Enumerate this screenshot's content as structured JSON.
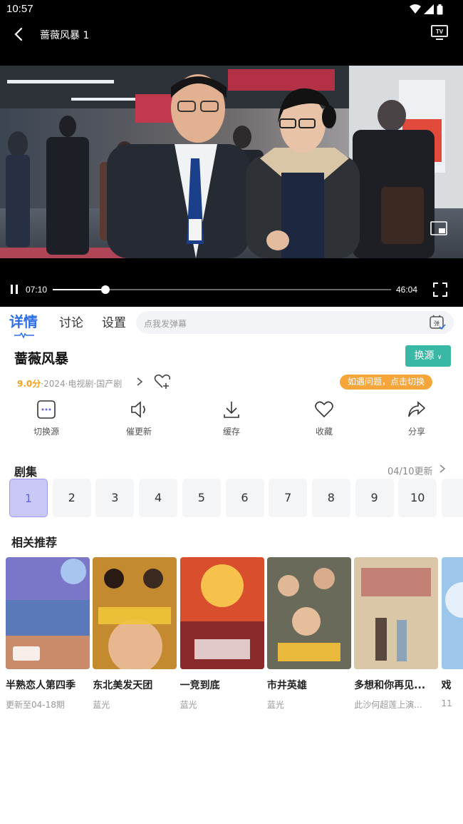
{
  "status": {
    "time": "10:57"
  },
  "player": {
    "title": "蔷薇风暴 1",
    "current_time": "07:10",
    "duration": "46:04",
    "progress": 0.155
  },
  "tabs": [
    {
      "label": "详情",
      "active": true
    },
    {
      "label": "讨论",
      "active": false
    },
    {
      "label": "设置",
      "active": false
    }
  ],
  "danmaku": {
    "placeholder": "点我发弹幕"
  },
  "show": {
    "title": "蔷薇风暴",
    "source_button": "换源",
    "score": "9.0分",
    "meta": "·2024·电视剧·国产剧",
    "tip": "如遇问题，点击切换"
  },
  "actions": [
    {
      "label": "切换源",
      "icon": "switch-source-icon"
    },
    {
      "label": "催更新",
      "icon": "speaker-icon"
    },
    {
      "label": "缓存",
      "icon": "download-icon"
    },
    {
      "label": "收藏",
      "icon": "heart-icon"
    },
    {
      "label": "分享",
      "icon": "share-icon"
    }
  ],
  "episodes": {
    "title": "剧集",
    "update": "04/10更新",
    "items": [
      "1",
      "2",
      "3",
      "4",
      "5",
      "6",
      "7",
      "8",
      "9",
      "10"
    ],
    "selected": "1"
  },
  "recommend": {
    "title": "相关推荐",
    "items": [
      {
        "name": "半熟恋人第四季",
        "sub": "更新至04-18期"
      },
      {
        "name": "东北美发天团",
        "sub": "蓝光"
      },
      {
        "name": "一竞到底",
        "sub": "蓝光"
      },
      {
        "name": "市井英雄",
        "sub": "蓝光"
      },
      {
        "name": "多想和你再见...",
        "sub": "此沙何超莲上演..."
      },
      {
        "name": "戏",
        "sub": "11"
      }
    ]
  },
  "colors": {
    "accent": "#2e6fe6",
    "source_button": "#3ab8a6",
    "tip": "#f6a53a",
    "score": "#f2a21f"
  }
}
